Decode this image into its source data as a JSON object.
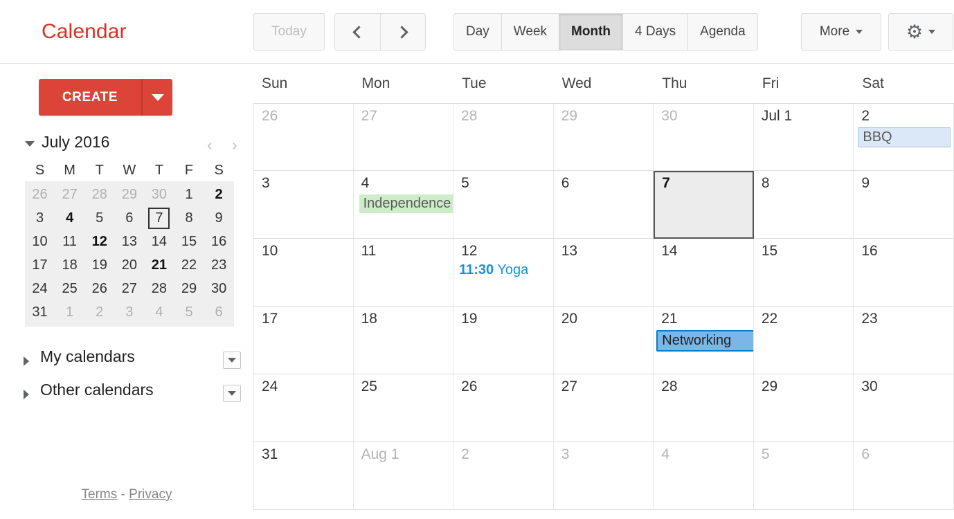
{
  "app": {
    "title": "Calendar",
    "brand_color": "#d93025"
  },
  "toolbar": {
    "today_label": "Today",
    "prev_label": "‹",
    "next_label": "›",
    "prev_icon": "chevron-left-icon",
    "next_icon": "chevron-right-icon",
    "views": [
      {
        "label": "Day",
        "active": false
      },
      {
        "label": "Week",
        "active": false
      },
      {
        "label": "Month",
        "active": true
      },
      {
        "label": "4 Days",
        "active": false
      },
      {
        "label": "Agenda",
        "active": false
      }
    ],
    "more_label": "More",
    "gear_icon": "gear-icon",
    "gear_glyph": "⚙"
  },
  "sidebar": {
    "create_label": "CREATE",
    "create_arrow_icon": "chevron-down-icon",
    "mini": {
      "title": "July 2016",
      "prev_label": "‹",
      "next_label": "›",
      "dow": [
        "S",
        "M",
        "T",
        "W",
        "T",
        "F",
        "S"
      ],
      "weeks": [
        [
          {
            "d": "26",
            "state": "other"
          },
          {
            "d": "27",
            "state": "other"
          },
          {
            "d": "28",
            "state": "other"
          },
          {
            "d": "29",
            "state": "other"
          },
          {
            "d": "30",
            "state": "other"
          },
          {
            "d": "1",
            "state": ""
          },
          {
            "d": "2",
            "state": "has-event"
          }
        ],
        [
          {
            "d": "3",
            "state": ""
          },
          {
            "d": "4",
            "state": "has-event"
          },
          {
            "d": "5",
            "state": ""
          },
          {
            "d": "6",
            "state": ""
          },
          {
            "d": "7",
            "state": "today-box"
          },
          {
            "d": "8",
            "state": ""
          },
          {
            "d": "9",
            "state": ""
          }
        ],
        [
          {
            "d": "10",
            "state": ""
          },
          {
            "d": "11",
            "state": ""
          },
          {
            "d": "12",
            "state": "has-event"
          },
          {
            "d": "13",
            "state": ""
          },
          {
            "d": "14",
            "state": ""
          },
          {
            "d": "15",
            "state": ""
          },
          {
            "d": "16",
            "state": ""
          }
        ],
        [
          {
            "d": "17",
            "state": ""
          },
          {
            "d": "18",
            "state": ""
          },
          {
            "d": "19",
            "state": ""
          },
          {
            "d": "20",
            "state": ""
          },
          {
            "d": "21",
            "state": "has-event"
          },
          {
            "d": "22",
            "state": ""
          },
          {
            "d": "23",
            "state": ""
          }
        ],
        [
          {
            "d": "24",
            "state": ""
          },
          {
            "d": "25",
            "state": ""
          },
          {
            "d": "26",
            "state": ""
          },
          {
            "d": "27",
            "state": ""
          },
          {
            "d": "28",
            "state": ""
          },
          {
            "d": "29",
            "state": ""
          },
          {
            "d": "30",
            "state": ""
          }
        ],
        [
          {
            "d": "31",
            "state": ""
          },
          {
            "d": "1",
            "state": "other"
          },
          {
            "d": "2",
            "state": "other"
          },
          {
            "d": "3",
            "state": "other"
          },
          {
            "d": "4",
            "state": "other"
          },
          {
            "d": "5",
            "state": "other"
          },
          {
            "d": "6",
            "state": "other"
          }
        ]
      ]
    },
    "my_calendars_label": "My calendars",
    "other_calendars_label": "Other calendars",
    "footer": {
      "terms": "Terms",
      "separator": "-",
      "privacy": "Privacy"
    }
  },
  "grid": {
    "dow": [
      "Sun",
      "Mon",
      "Tue",
      "Wed",
      "Thu",
      "Fri",
      "Sat"
    ],
    "weeks": [
      [
        {
          "num": "26",
          "other": true
        },
        {
          "num": "27",
          "other": true
        },
        {
          "num": "28",
          "other": true
        },
        {
          "num": "29",
          "other": true
        },
        {
          "num": "30",
          "other": true
        },
        {
          "num": "Jul 1",
          "other": false
        },
        {
          "num": "2",
          "other": false,
          "event": {
            "title": "BBQ",
            "style": "ev-chip ev-blue-light"
          }
        }
      ],
      [
        {
          "num": "3",
          "other": false
        },
        {
          "num": "4",
          "other": false,
          "event": {
            "title": "Independence Day",
            "style": "ev-chip ev-green"
          }
        },
        {
          "num": "5",
          "other": false
        },
        {
          "num": "6",
          "other": false
        },
        {
          "num": "7",
          "other": false,
          "today": true
        },
        {
          "num": "8",
          "other": false
        },
        {
          "num": "9",
          "other": false
        }
      ],
      [
        {
          "num": "10",
          "other": false
        },
        {
          "num": "11",
          "other": false
        },
        {
          "num": "12",
          "other": false,
          "event": {
            "time": "11:30",
            "title": "Yoga",
            "style": "ev-plain"
          }
        },
        {
          "num": "13",
          "other": false
        },
        {
          "num": "14",
          "other": false
        },
        {
          "num": "15",
          "other": false
        },
        {
          "num": "16",
          "other": false
        }
      ],
      [
        {
          "num": "17",
          "other": false
        },
        {
          "num": "18",
          "other": false
        },
        {
          "num": "19",
          "other": false
        },
        {
          "num": "20",
          "other": false
        },
        {
          "num": "21",
          "other": false,
          "event": {
            "title": "Networking",
            "style": "ev-chip ev-blue-strong"
          }
        },
        {
          "num": "22",
          "other": false
        },
        {
          "num": "23",
          "other": false
        }
      ],
      [
        {
          "num": "24",
          "other": false
        },
        {
          "num": "25",
          "other": false
        },
        {
          "num": "26",
          "other": false
        },
        {
          "num": "27",
          "other": false
        },
        {
          "num": "28",
          "other": false
        },
        {
          "num": "29",
          "other": false
        },
        {
          "num": "30",
          "other": false
        }
      ],
      [
        {
          "num": "31",
          "other": false
        },
        {
          "num": "Aug 1",
          "other": true
        },
        {
          "num": "2",
          "other": true
        },
        {
          "num": "3",
          "other": true
        },
        {
          "num": "4",
          "other": true
        },
        {
          "num": "5",
          "other": true
        },
        {
          "num": "6",
          "other": true
        }
      ]
    ]
  }
}
